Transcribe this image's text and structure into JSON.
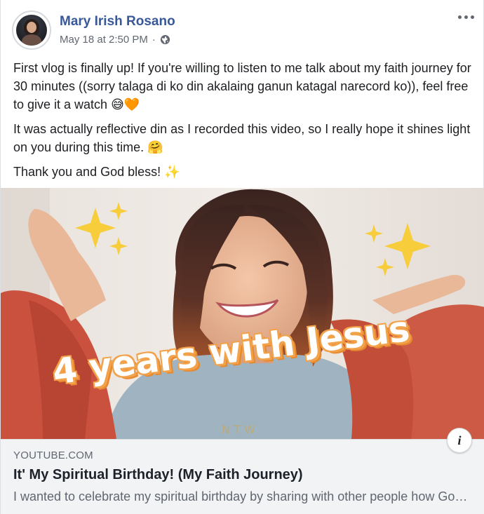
{
  "post": {
    "author": "Mary Irish Rosano",
    "timestamp": "May 18 at 2:50 PM",
    "separator": "·",
    "privacy_icon": "globe-icon",
    "more_icon": "more-options-icon",
    "paragraphs": [
      {
        "text": "First vlog is finally up! If you're willing to listen to me talk about my faith journey for 30 minutes ((sorry talaga di ko din akalaing ganun katagal narecord ko)), feel free to give it a watch ",
        "emoji": "😅🧡"
      },
      {
        "text": "It was actually reflective din as I recorded this video, so I really hope it shines light on you during this time. ",
        "emoji": "🤗"
      },
      {
        "text": "Thank you and God bless! ",
        "emoji": "✨"
      }
    ]
  },
  "link_preview": {
    "thumbnail_text": "4 years with Jesus",
    "info_icon": "i",
    "domain": "YOUTUBE.COM",
    "title": "It' My Spiritual Birthday! (My Faith Journey)",
    "description": "I wanted to celebrate my spiritual birthday by sharing with other people how God has been working in my life for the past four years."
  },
  "colors": {
    "author_link": "#385898",
    "meta_gray": "#606770",
    "footer_bg": "#f2f3f5",
    "sparkle": "#f7cd3b",
    "jacket": "#c9513e"
  }
}
